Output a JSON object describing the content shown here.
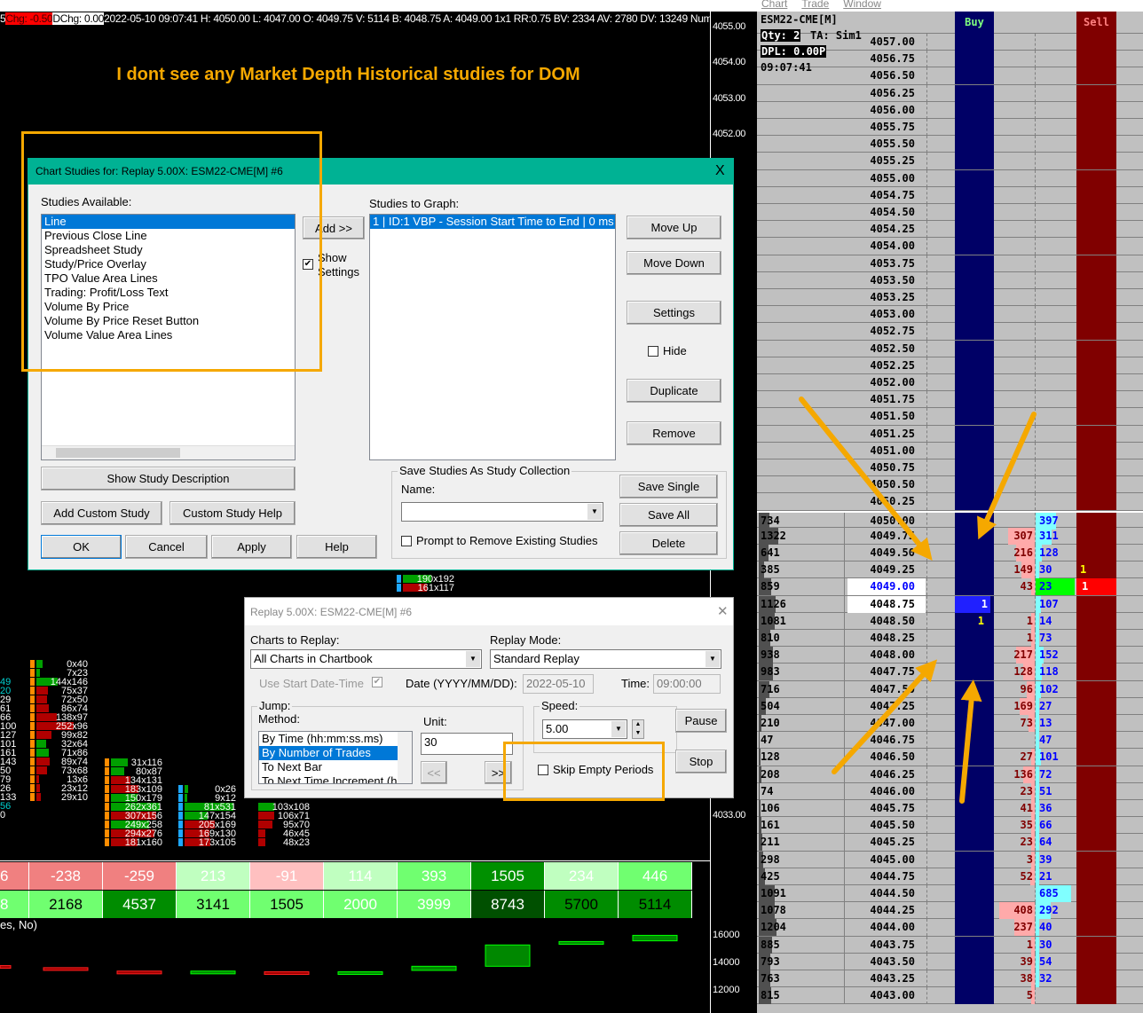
{
  "menu": [
    "Chart",
    "Trade",
    "Window"
  ],
  "chart_header": {
    "prefix": "5",
    "chg": "Chg: -0.50",
    "dchg": "DChg: 0.00",
    "info": "2022-05-10 09:07:41 H: 4050.00 L: 4047.00 O: 4049.75 V: 5114 B: 4048.75 A: 4049.00 1x1 RR:0.75 BV: 2334 AV: 2780 DV: 13249 Numbe"
  },
  "annotation": "I dont see any Market Depth Historical studies for DOM",
  "price_axis": [
    {
      "label": "4055.00",
      "y": 4055
    },
    {
      "label": "4054.00",
      "y": 4054
    },
    {
      "label": "4053.00",
      "y": 4053
    },
    {
      "label": "4052.00",
      "y": 4052
    },
    {
      "label": "4033.00",
      "y": 4033
    }
  ],
  "footprint": {
    "left_partial": [
      "49",
      "20",
      "29",
      "61",
      "66",
      "100",
      "127",
      "101",
      "161",
      "143",
      "50",
      "79",
      "26",
      "133",
      "56",
      "0"
    ],
    "columns": [
      {
        "name": "col1",
        "cells": [
          "0x40",
          "7x23",
          "144x146",
          "75x37",
          "72x50",
          "86x74",
          "138x97",
          "252x96",
          "99x82",
          "32x64",
          "71x86",
          "89x74",
          "73x68",
          "13x6",
          "23x12",
          "29x10"
        ],
        "marker": "#ff8c00"
      },
      {
        "name": "col2",
        "cells": [
          "31x116",
          "80x87",
          "134x131",
          "183x109",
          "150x179",
          "262x361",
          "307x156",
          "249x258",
          "294x276",
          "181x160"
        ],
        "marker": "#ff8c00"
      },
      {
        "name": "col3",
        "cells": [
          "0x26",
          "9x12",
          "81x531",
          "147x154",
          "205x169",
          "169x130",
          "173x105"
        ],
        "marker": "#1ea7ff"
      },
      {
        "name": "col4",
        "cells": [
          "103x108",
          "106x71",
          "95x70",
          "46x45",
          "48x23"
        ],
        "marker": ""
      },
      {
        "name": "col5",
        "cells": [
          "190x192",
          "161x117"
        ],
        "marker": "#1ea7ff"
      }
    ]
  },
  "bar_table": {
    "delta": [
      {
        "v": "6",
        "bg": "#f08080",
        "fg": "#fff"
      },
      {
        "v": "-238",
        "bg": "#f08080",
        "fg": "#fff"
      },
      {
        "v": "-259",
        "bg": "#f08080",
        "fg": "#fff"
      },
      {
        "v": "213",
        "bg": "#c0ffc0",
        "fg": "#fff"
      },
      {
        "v": "-91",
        "bg": "#ffc0c0",
        "fg": "#fff"
      },
      {
        "v": "114",
        "bg": "#c0ffc0",
        "fg": "#fff"
      },
      {
        "v": "393",
        "bg": "#70ff70",
        "fg": "#fff"
      },
      {
        "v": "1505",
        "bg": "#009000",
        "fg": "#fff"
      },
      {
        "v": "234",
        "bg": "#c0ffc0",
        "fg": "#fff"
      },
      {
        "v": "446",
        "bg": "#70ff70",
        "fg": "#fff"
      }
    ],
    "volume": [
      {
        "v": "8",
        "bg": "#70ff70",
        "fg": "#fff"
      },
      {
        "v": "2168",
        "bg": "#70ff70",
        "fg": "#000"
      },
      {
        "v": "4537",
        "bg": "#008c00",
        "fg": "#fff"
      },
      {
        "v": "3141",
        "bg": "#70ff70",
        "fg": "#000"
      },
      {
        "v": "1505",
        "bg": "#70ff70",
        "fg": "#000"
      },
      {
        "v": "2000",
        "bg": "#70ff70",
        "fg": "#fff"
      },
      {
        "v": "3999",
        "bg": "#70ff70",
        "fg": "#fff"
      },
      {
        "v": "8743",
        "bg": "#005000",
        "fg": "#fff"
      },
      {
        "v": "5700",
        "bg": "#008c00",
        "fg": "#000"
      },
      {
        "v": "5114",
        "bg": "#008c00",
        "fg": "#000"
      }
    ]
  },
  "chart_data": {
    "type": "candlestick",
    "title": "es, No)",
    "ylim": [
      11500,
      16500
    ],
    "yticks": [
      "16000",
      "14000",
      "12000"
    ],
    "candles": [
      {
        "o": 13900,
        "c": 13800
      },
      {
        "o": 13750,
        "c": 13550
      },
      {
        "o": 13500,
        "c": 13300
      },
      {
        "o": 13300,
        "c": 13500
      },
      {
        "o": 13450,
        "c": 13350
      },
      {
        "o": 13350,
        "c": 13450
      },
      {
        "o": 13550,
        "c": 13850
      },
      {
        "o": 13850,
        "c": 15400
      },
      {
        "o": 15450,
        "c": 15650
      },
      {
        "o": 15700,
        "c": 16100
      }
    ]
  },
  "dom": {
    "symbol": "ESM22-CME[M]",
    "qty": "Qty: 2",
    "account": "TA: Sim1",
    "dpl": "DPL: 0.00P",
    "time": "09:07:41",
    "buy_label": "Buy",
    "sell_label": "Sell",
    "empty_prices": [
      "4057.00",
      "4056.75",
      "4056.50",
      "4056.25",
      "4056.00",
      "4055.75",
      "4055.50",
      "4055.25",
      "4055.00",
      "4054.75",
      "4054.50",
      "4054.25",
      "4054.00",
      "4053.75",
      "4053.50",
      "4053.25",
      "4053.00",
      "4052.75",
      "4052.50",
      "4052.25",
      "4052.00",
      "4051.75",
      "4051.50",
      "4051.25",
      "4051.00",
      "4050.75",
      "4050.50",
      "4050.25"
    ],
    "rows": [
      [
        "734",
        "4050.00",
        "",
        "",
        "397",
        "",
        ""
      ],
      [
        "1322",
        "4049.75",
        "",
        "307",
        "311",
        "",
        ""
      ],
      [
        "641",
        "4049.50",
        "",
        "216",
        "128",
        "",
        ""
      ],
      [
        "385",
        "4049.25",
        "",
        "149",
        "30",
        "1",
        ""
      ],
      [
        "859",
        "4049.00",
        "",
        "43",
        "23",
        "",
        "1"
      ],
      [
        "1126",
        "4048.75",
        "1",
        "",
        "107",
        "",
        ""
      ],
      [
        "1081",
        "4048.50",
        "1y",
        "1",
        "14",
        "",
        ""
      ],
      [
        "810",
        "4048.25",
        "",
        "1",
        "73",
        "",
        ""
      ],
      [
        "938",
        "4048.00",
        "",
        "217",
        "152",
        "",
        ""
      ],
      [
        "983",
        "4047.75",
        "",
        "128",
        "118",
        "",
        ""
      ],
      [
        "716",
        "4047.50",
        "",
        "96",
        "102",
        "",
        ""
      ],
      [
        "504",
        "4047.25",
        "",
        "169",
        "27",
        "",
        ""
      ],
      [
        "210",
        "4047.00",
        "",
        "73",
        "13",
        "",
        ""
      ],
      [
        "47",
        "4046.75",
        "",
        "",
        "47",
        "",
        ""
      ],
      [
        "128",
        "4046.50",
        "",
        "27",
        "101",
        "",
        ""
      ],
      [
        "208",
        "4046.25",
        "",
        "136",
        "72",
        "",
        ""
      ],
      [
        "74",
        "4046.00",
        "",
        "23",
        "51",
        "",
        ""
      ],
      [
        "106",
        "4045.75",
        "",
        "41",
        "36",
        "",
        ""
      ],
      [
        "161",
        "4045.50",
        "",
        "35",
        "66",
        "",
        ""
      ],
      [
        "211",
        "4045.25",
        "",
        "23",
        "64",
        "",
        ""
      ],
      [
        "298",
        "4045.00",
        "",
        "3",
        "39",
        "",
        ""
      ],
      [
        "425",
        "4044.75",
        "",
        "52",
        "21",
        "",
        ""
      ],
      [
        "1091",
        "4044.50",
        "",
        "",
        "685",
        "",
        ""
      ],
      [
        "1078",
        "4044.25",
        "",
        "408",
        "292",
        "",
        ""
      ],
      [
        "1204",
        "4044.00",
        "",
        "237",
        "40",
        "",
        ""
      ],
      [
        "885",
        "4043.75",
        "",
        "1",
        "30",
        "",
        ""
      ],
      [
        "793",
        "4043.50",
        "",
        "39",
        "54",
        "",
        ""
      ],
      [
        "763",
        "4043.25",
        "",
        "38",
        "32",
        "",
        ""
      ],
      [
        "815",
        "4043.00",
        "",
        "5",
        "",
        "",
        ""
      ]
    ],
    "last_price": "4049.00",
    "bid_price": "4048.75"
  },
  "studies_dialog": {
    "title": "Chart Studies for: Replay 5.00X: ESM22-CME[M]  #6",
    "close": "X",
    "available_label": "Studies Available:",
    "available": [
      "Line",
      "Previous Close Line",
      "Spreadsheet Study",
      "Study/Price Overlay",
      "TPO Value Area Lines",
      "Trading: Profit/Loss Text",
      "Volume By Price",
      "Volume By Price Reset Button",
      "Volume Value Area Lines"
    ],
    "add": "Add >>",
    "show_settings": "Show Settings",
    "graph_label": "Studies to Graph:",
    "graph": [
      "1 | ID:1  VBP - Session Start Time to End | 0 ms"
    ],
    "move_up": "Move Up",
    "move_down": "Move Down",
    "settings": "Settings",
    "hide": "Hide",
    "duplicate": "Duplicate",
    "remove": "Remove",
    "show_desc": "Show Study Description",
    "add_custom": "Add Custom Study",
    "custom_help": "Custom Study Help",
    "ok": "OK",
    "cancel": "Cancel",
    "apply": "Apply",
    "help": "Help",
    "collection_group": "Save Studies As Study Collection",
    "name_label": "Name:",
    "name_value": "",
    "prompt_remove": "Prompt to Remove Existing Studies",
    "save_single": "Save Single",
    "save_all": "Save All",
    "delete": "Delete"
  },
  "replay_dialog": {
    "title": "Replay 5.00X: ESM22-CME[M]  #6",
    "close": "✕",
    "charts_label": "Charts to Replay:",
    "charts_value": "All Charts in Chartbook",
    "mode_label": "Replay Mode:",
    "mode_value": "Standard Replay",
    "use_start": "Use Start Date-Time",
    "date_label": "Date (YYYY/MM/DD):",
    "date_value": "2022-05-10",
    "time_label": "Time:",
    "time_value": "09:00:00",
    "jump_group": "Jump:",
    "method_label": "Method:",
    "methods": [
      "By Time (hh:mm:ss.ms)",
      "By Number of Trades",
      "To Next Bar",
      "To Next Time Increment (h"
    ],
    "unit_label": "Unit:",
    "unit_value": "30",
    "back": "<<",
    "fwd": ">>",
    "speed_group": "Speed:",
    "speed_value": "5.00",
    "skip_empty": "Skip Empty Periods",
    "pause": "Pause",
    "stop": "Stop"
  },
  "colors": {
    "accent": "#f5a800",
    "titlebar": "#00b294",
    "buy": "#000066",
    "sell": "#800000"
  }
}
